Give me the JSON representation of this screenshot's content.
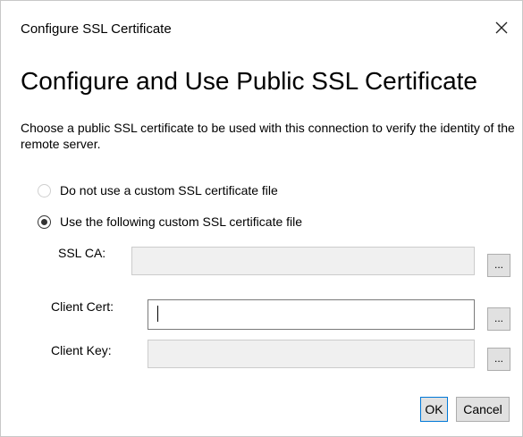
{
  "window": {
    "title": "Configure SSL Certificate",
    "close_icon": "close-icon"
  },
  "main": {
    "heading": "Configure and Use Public SSL Certificate",
    "description": "Choose a public SSL certificate to be used with this connection to verify the identity of the remote server."
  },
  "radios": {
    "option_none": {
      "label": "Do not use a custom SSL certificate file",
      "selected": false
    },
    "option_custom": {
      "label": "Use the following custom SSL certificate file",
      "selected": true
    }
  },
  "fields": {
    "ssl_ca": {
      "label": "SSL CA:",
      "value": "",
      "browse_label": "..."
    },
    "client_cert": {
      "label": "Client Cert:",
      "value": "",
      "browse_label": "..."
    },
    "client_key": {
      "label": "Client Key:",
      "value": "",
      "browse_label": "..."
    }
  },
  "buttons": {
    "ok": "OK",
    "cancel": "Cancel"
  },
  "colors": {
    "accent": "#0078d7",
    "disabled_field": "#f0f0f0",
    "button_face": "#e1e1e1"
  }
}
